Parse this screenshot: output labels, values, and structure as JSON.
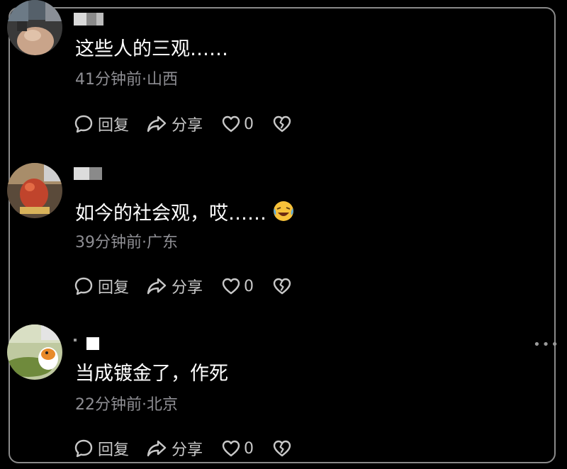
{
  "comments": [
    {
      "text": "这些人的三观……",
      "time": "41分钟前",
      "region": "山西",
      "reply_label": "回复",
      "share_label": "分享",
      "like_count": "0"
    },
    {
      "text": "如今的社会观，哎……",
      "emoji": "laughing-crying-emoji",
      "time": "39分钟前",
      "region": "广东",
      "reply_label": "回复",
      "share_label": "分享",
      "like_count": "0"
    },
    {
      "text": "当成镀金了，作死",
      "time": "22分钟前",
      "region": "北京",
      "reply_label": "回复",
      "share_label": "分享",
      "like_count": "0"
    }
  ],
  "meta_separator": "·",
  "more_glyph": "•••",
  "icons": {
    "reply": "comment-bubble-icon",
    "share": "share-arrow-icon",
    "like": "heart-icon",
    "dislike": "broken-heart-icon"
  },
  "colors": {
    "background": "#000000",
    "text": "#ffffff",
    "meta": "#8e8e93",
    "action": "#c8c8c8",
    "frame": "#8a8a8a"
  }
}
